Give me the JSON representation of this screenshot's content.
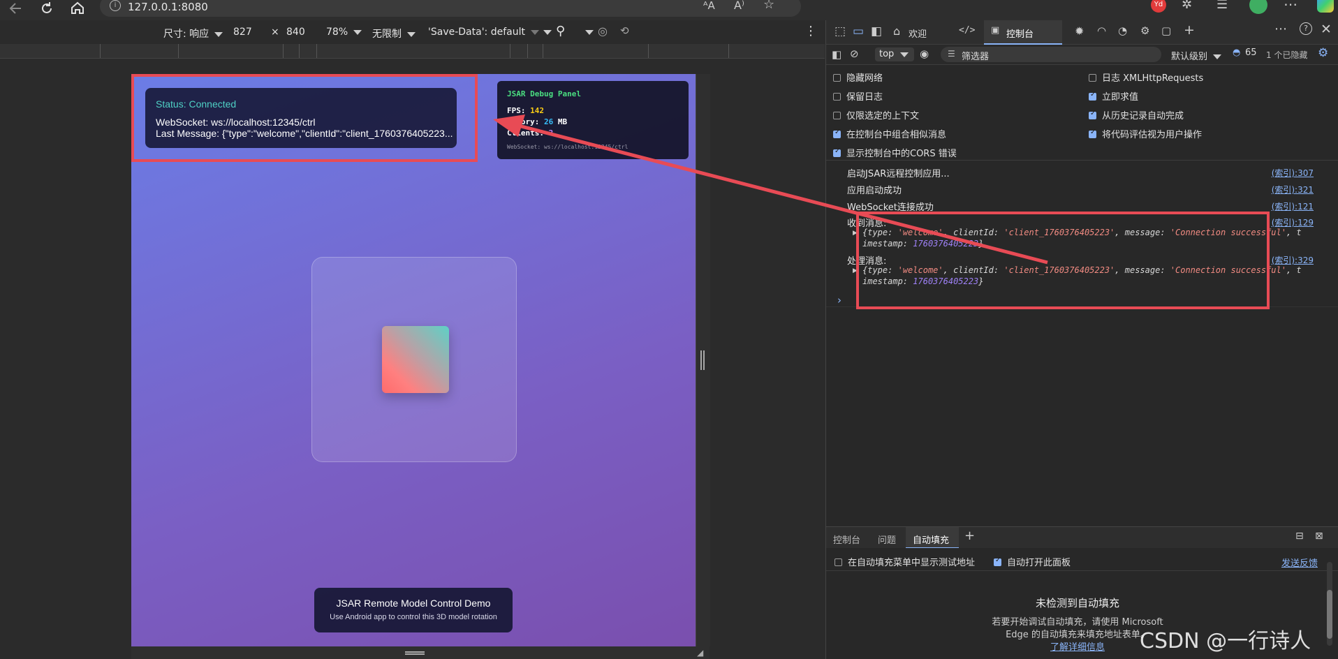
{
  "browser": {
    "address": "127.0.0.1:8080",
    "avatar_text": "Yd"
  },
  "device_toolbar": {
    "size_label": "尺寸: 响应",
    "width": "827",
    "times": "×",
    "height": "840",
    "zoom": "78%",
    "throttle": "无限制",
    "save_data": "'Save-Data': default"
  },
  "page": {
    "status": {
      "title": "Status: Connected",
      "websocket": "WebSocket: ws://localhost:12345/ctrl",
      "last_message": "Last Message: {\"type\":\"welcome\",\"clientId\":\"client_1760376405223..."
    },
    "debug": {
      "title": "JSAR Debug Panel",
      "fps_label": "FPS:",
      "fps_value": "142",
      "memory_label": "Memory:",
      "memory_value": "26",
      "memory_unit": "MB",
      "clients_label": "Clients:",
      "clients_value": "2",
      "websocket": "WebSocket: ws://localhost:12345/ctrl"
    },
    "footer": {
      "title": "JSAR Remote Model Control Demo",
      "subtitle": "Use Android app to control this 3D model rotation"
    }
  },
  "devtools": {
    "tabs": {
      "welcome": "欢迎",
      "console": "控制台"
    },
    "filter": {
      "context": "top",
      "placeholder": "筛选器",
      "level": "默认级别",
      "count": "65",
      "hidden": "1 个已隐藏"
    },
    "settings": {
      "hide_network": "隐藏网络",
      "preserve_log": "保留日志",
      "selected_context": "仅限选定的上下文",
      "group_similar": "在控制台中组合相似消息",
      "cors_errors": "显示控制台中的CORS 错误",
      "log_xhr": "日志 XMLHttpRequests",
      "eager_eval": "立即求值",
      "autocomplete": "从历史记录自动完成",
      "treat_eval": "将代码评估视为用户操作"
    },
    "logs": [
      {
        "text": "启动JSAR远程控制应用...",
        "src": "(索引):307"
      },
      {
        "text": "应用启动成功",
        "src": "(索引):321"
      },
      {
        "text": "WebSocket连接成功",
        "src": "(索引):121"
      },
      {
        "text": "收到消息:",
        "src": "(索引):129"
      },
      {
        "text": "处理消息:",
        "src": "(索引):329"
      }
    ],
    "object": {
      "k_type": "type:",
      "v_type": "'welcome'",
      "k_client": "clientId:",
      "v_client": "'client_1760376405223'",
      "k_message": "message:",
      "v_message": "'Connection successful'",
      "k_ts": "imestamp:",
      "v_ts": "1760376405223",
      "trail_t": "t",
      "close": "}"
    },
    "drawer": {
      "tab_console": "控制台",
      "tab_issues": "问题",
      "tab_autofill": "自动填充",
      "show_test_addr": "在自动填充菜单中显示测试地址",
      "auto_open": "自动打开此面板",
      "feedback": "发送反馈",
      "empty_title": "未检测到自动填充",
      "empty_desc1": "若要开始调试自动填充，请使用 Microsoft",
      "empty_desc2": "Edge 的自动填充来填充地址表单。",
      "learn_more": "了解详细信息"
    }
  },
  "watermark": "CSDN @一行诗人",
  "colors": {
    "annotation": "#e84b55",
    "accent": "#8ab4f8",
    "status_green": "#4fd1c5",
    "debug_green": "#4ade80",
    "fps_yellow": "#facc15"
  }
}
